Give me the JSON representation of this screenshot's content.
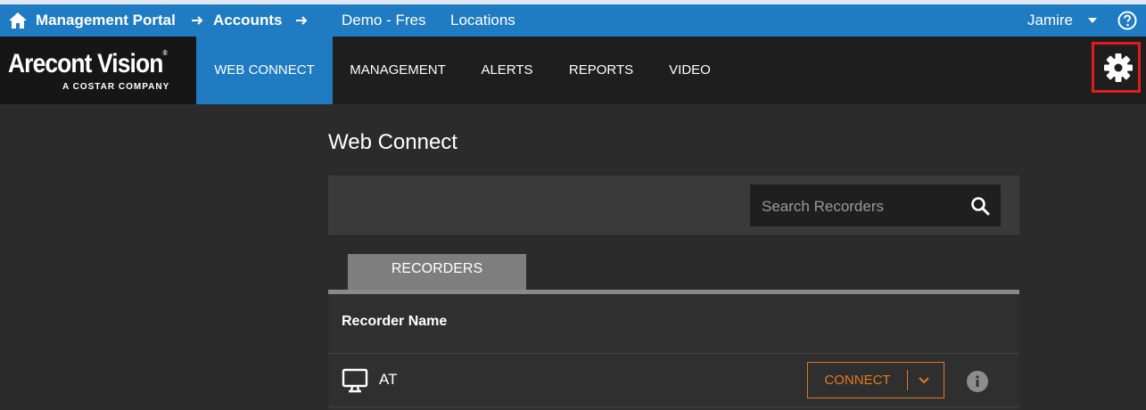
{
  "breadcrumb": {
    "items": [
      "Management Portal",
      "Accounts",
      "Demo - Fres",
      "Locations"
    ],
    "user": "Jamire"
  },
  "logo": {
    "name": "Arecont Vision",
    "tagline": "A COSTAR COMPANY"
  },
  "nav": {
    "items": [
      "WEB CONNECT",
      "MANAGEMENT",
      "ALERTS",
      "REPORTS",
      "VIDEO"
    ],
    "active": "WEB CONNECT"
  },
  "page": {
    "title": "Web Connect",
    "search": {
      "placeholder": "Search Recorders",
      "value": ""
    },
    "tab": "RECORDERS",
    "table": {
      "column": "Recorder Name",
      "rows": [
        {
          "name": "AT",
          "action": "CONNECT"
        }
      ]
    }
  },
  "colors": {
    "accent_blue": "#1f7bc2",
    "connect_orange": "#e07a1f",
    "highlight_red": "#e21b1b",
    "background": "#2b2b2b"
  },
  "icons": [
    "home-icon",
    "arrow-right-icon",
    "caret-down-icon",
    "help-icon",
    "gear-icon",
    "search-icon",
    "monitor-icon",
    "chevron-down-icon",
    "info-icon"
  ]
}
